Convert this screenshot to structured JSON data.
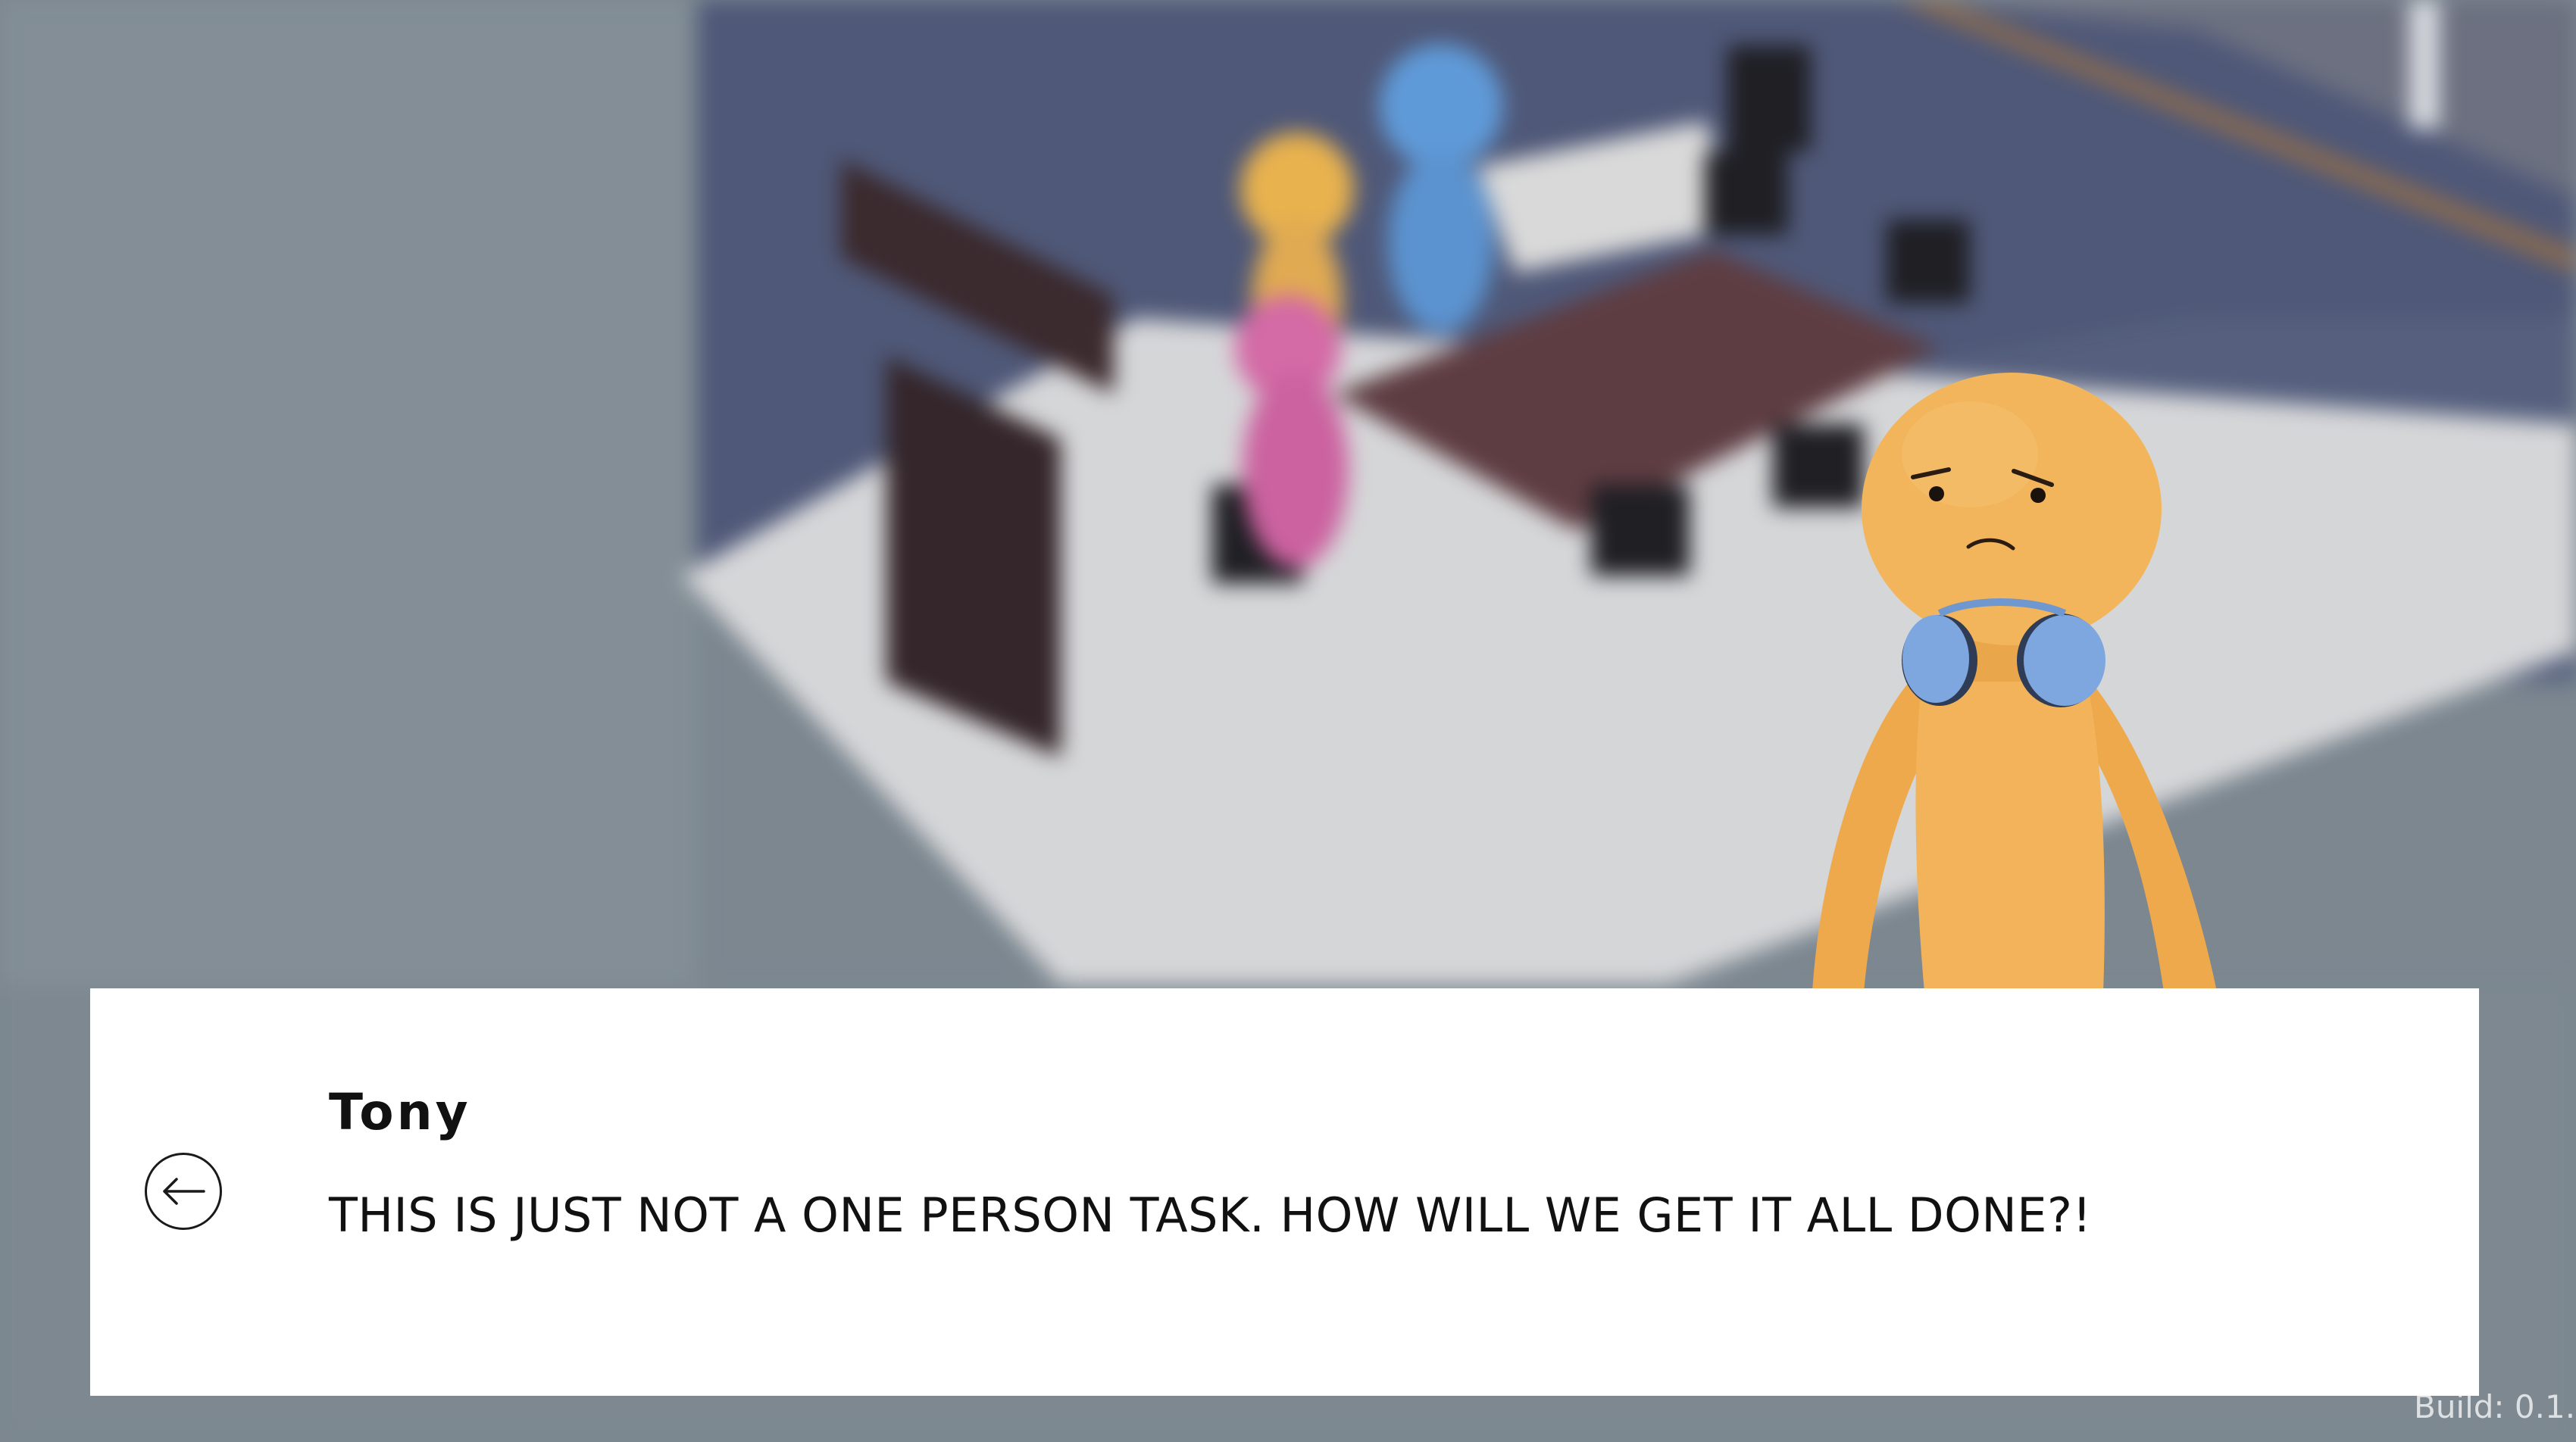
{
  "dialog": {
    "speaker": "Tony",
    "text": "THIS IS JUST NOT A ONE PERSON TASK. HOW WILL WE GET IT ALL DONE?!"
  },
  "build": {
    "label": "Build: 0.1."
  },
  "icons": {
    "back": "arrow-left-icon"
  },
  "colors": {
    "character_skin": "#f2b55c",
    "headphones": "#7ea7e0",
    "dialog_bg": "#ffffff",
    "text": "#111111"
  }
}
